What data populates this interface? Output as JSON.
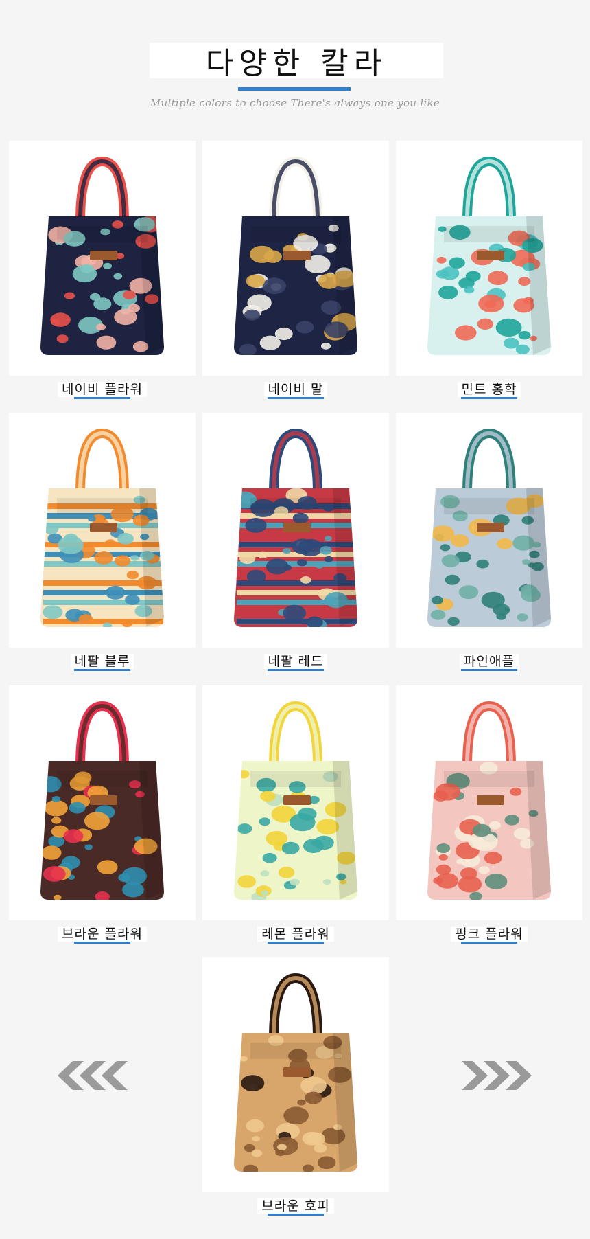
{
  "header": {
    "title": "다양한 칼라",
    "subtitle": "Multiple colors to choose  There's always one you like"
  },
  "products": [
    {
      "label": "네이비 플라워",
      "pattern": "navy-floral",
      "colors": [
        "#1d2340",
        "#e8514a",
        "#7fc8c2",
        "#f3b3a6"
      ]
    },
    {
      "label": "네이비 말",
      "pattern": "navy-horse",
      "colors": [
        "#1e2444",
        "#f2f0e8",
        "#d9a74a",
        "#3a4268"
      ]
    },
    {
      "label": "민트 홍학",
      "pattern": "mint-flamingo",
      "colors": [
        "#d8f1ee",
        "#1fa59a",
        "#4bc2c0",
        "#f06a55"
      ]
    },
    {
      "label": "네팔 블루",
      "pattern": "nepal-blue",
      "colors": [
        "#f7e4c0",
        "#f28a2e",
        "#3d8fb8",
        "#7fc6c4"
      ]
    },
    {
      "label": "네팔 레드",
      "pattern": "nepal-red",
      "colors": [
        "#c73a45",
        "#2e4a7a",
        "#f0d9a6",
        "#4fa3b8"
      ]
    },
    {
      "label": "파인애플",
      "pattern": "pineapple",
      "colors": [
        "#bccbd8",
        "#2f7f7a",
        "#6fb0a6",
        "#f1b94a"
      ]
    },
    {
      "label": "브라운 플라워",
      "pattern": "brown-flower",
      "colors": [
        "#4a2a26",
        "#e8314f",
        "#f2a33a",
        "#2f8fb0"
      ]
    },
    {
      "label": "레몬 플라워",
      "pattern": "lemon-flower",
      "colors": [
        "#eef5c8",
        "#f2d53a",
        "#38a8a3",
        "#bde0c0"
      ]
    },
    {
      "label": "핑크 플라워",
      "pattern": "pink-flower",
      "colors": [
        "#f4c6c0",
        "#e8614f",
        "#5f8f7c",
        "#f7ead8"
      ]
    },
    {
      "label": "브라운 호피",
      "pattern": "brown-leopard",
      "colors": [
        "#d8a56a",
        "#2a1a12",
        "#8a5a32",
        "#f0c98e"
      ]
    }
  ],
  "nav": {
    "prev_icon": "chevron-left-triple-icon",
    "next_icon": "chevron-right-triple-icon",
    "arrow_color": "#9a9a9a"
  },
  "accent": "#2f7fd0"
}
